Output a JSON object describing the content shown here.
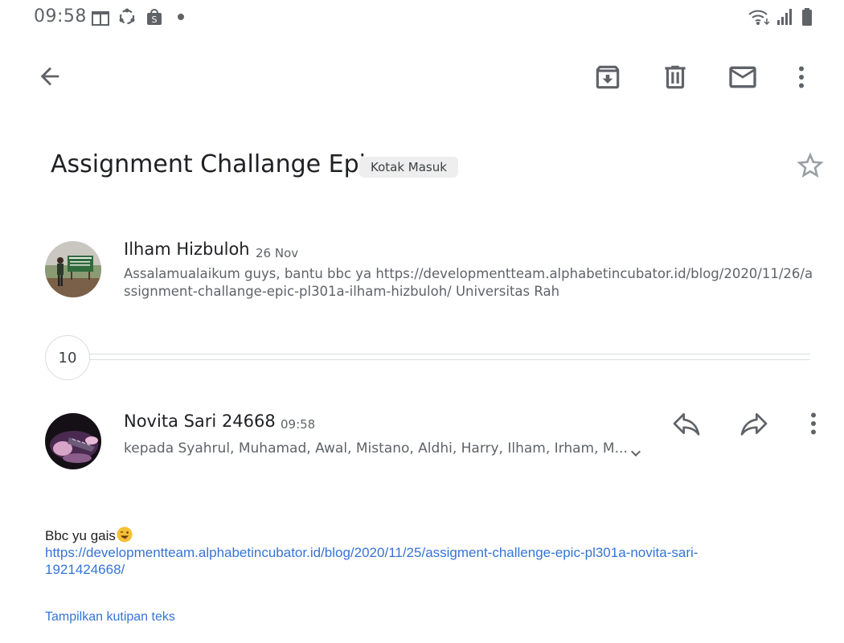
{
  "status_bar": {
    "time": "09:58",
    "icons": [
      "gift-icon",
      "sync-icon",
      "shopee-bag-icon",
      "notification-dot-icon",
      "wifi-icon",
      "signal-icon",
      "battery-icon"
    ]
  },
  "toolbar": {
    "icons": [
      "back-arrow-icon",
      "archive-icon",
      "delete-icon",
      "mark-unread-icon",
      "more-vert-icon"
    ]
  },
  "email": {
    "subject": "Assignment Challange Epic",
    "label": "Kotak Masuk",
    "starred": false
  },
  "messages": [
    {
      "sender": "Ilham Hizbuloh",
      "date": "26 Nov",
      "snippet": "Assalamualaikum guys, bantu bbc ya https://developmentteam.alphabetincubator.id/blog/2020/11/26/assignment-challange-epic-pl301a-ilham-hizbuloh/ Universitas Rah"
    },
    {
      "collapsed_count": "10"
    },
    {
      "sender": "Novita Sari 24668",
      "time": "09:58",
      "recipients": "kepada Syahrul, Muhamad, Awal, Mistano, Aldhi, Harry, Ilham, Irham, M...",
      "body_text": "Bbc yu gais",
      "link": "https://developmentteam.alphabetincubator.id/blog/2020/11/25/assigment-challenge-epic-pl301a-novita-sari-1921424668/",
      "show_quoted": "Tampilkan kutipan teks"
    }
  ],
  "colors": {
    "icon": "#5f6368",
    "text_primary": "#202124",
    "text_secondary": "#5f6368",
    "link": "#3574d6",
    "chip_bg": "#eeeeee",
    "divider": "#dadce0"
  }
}
